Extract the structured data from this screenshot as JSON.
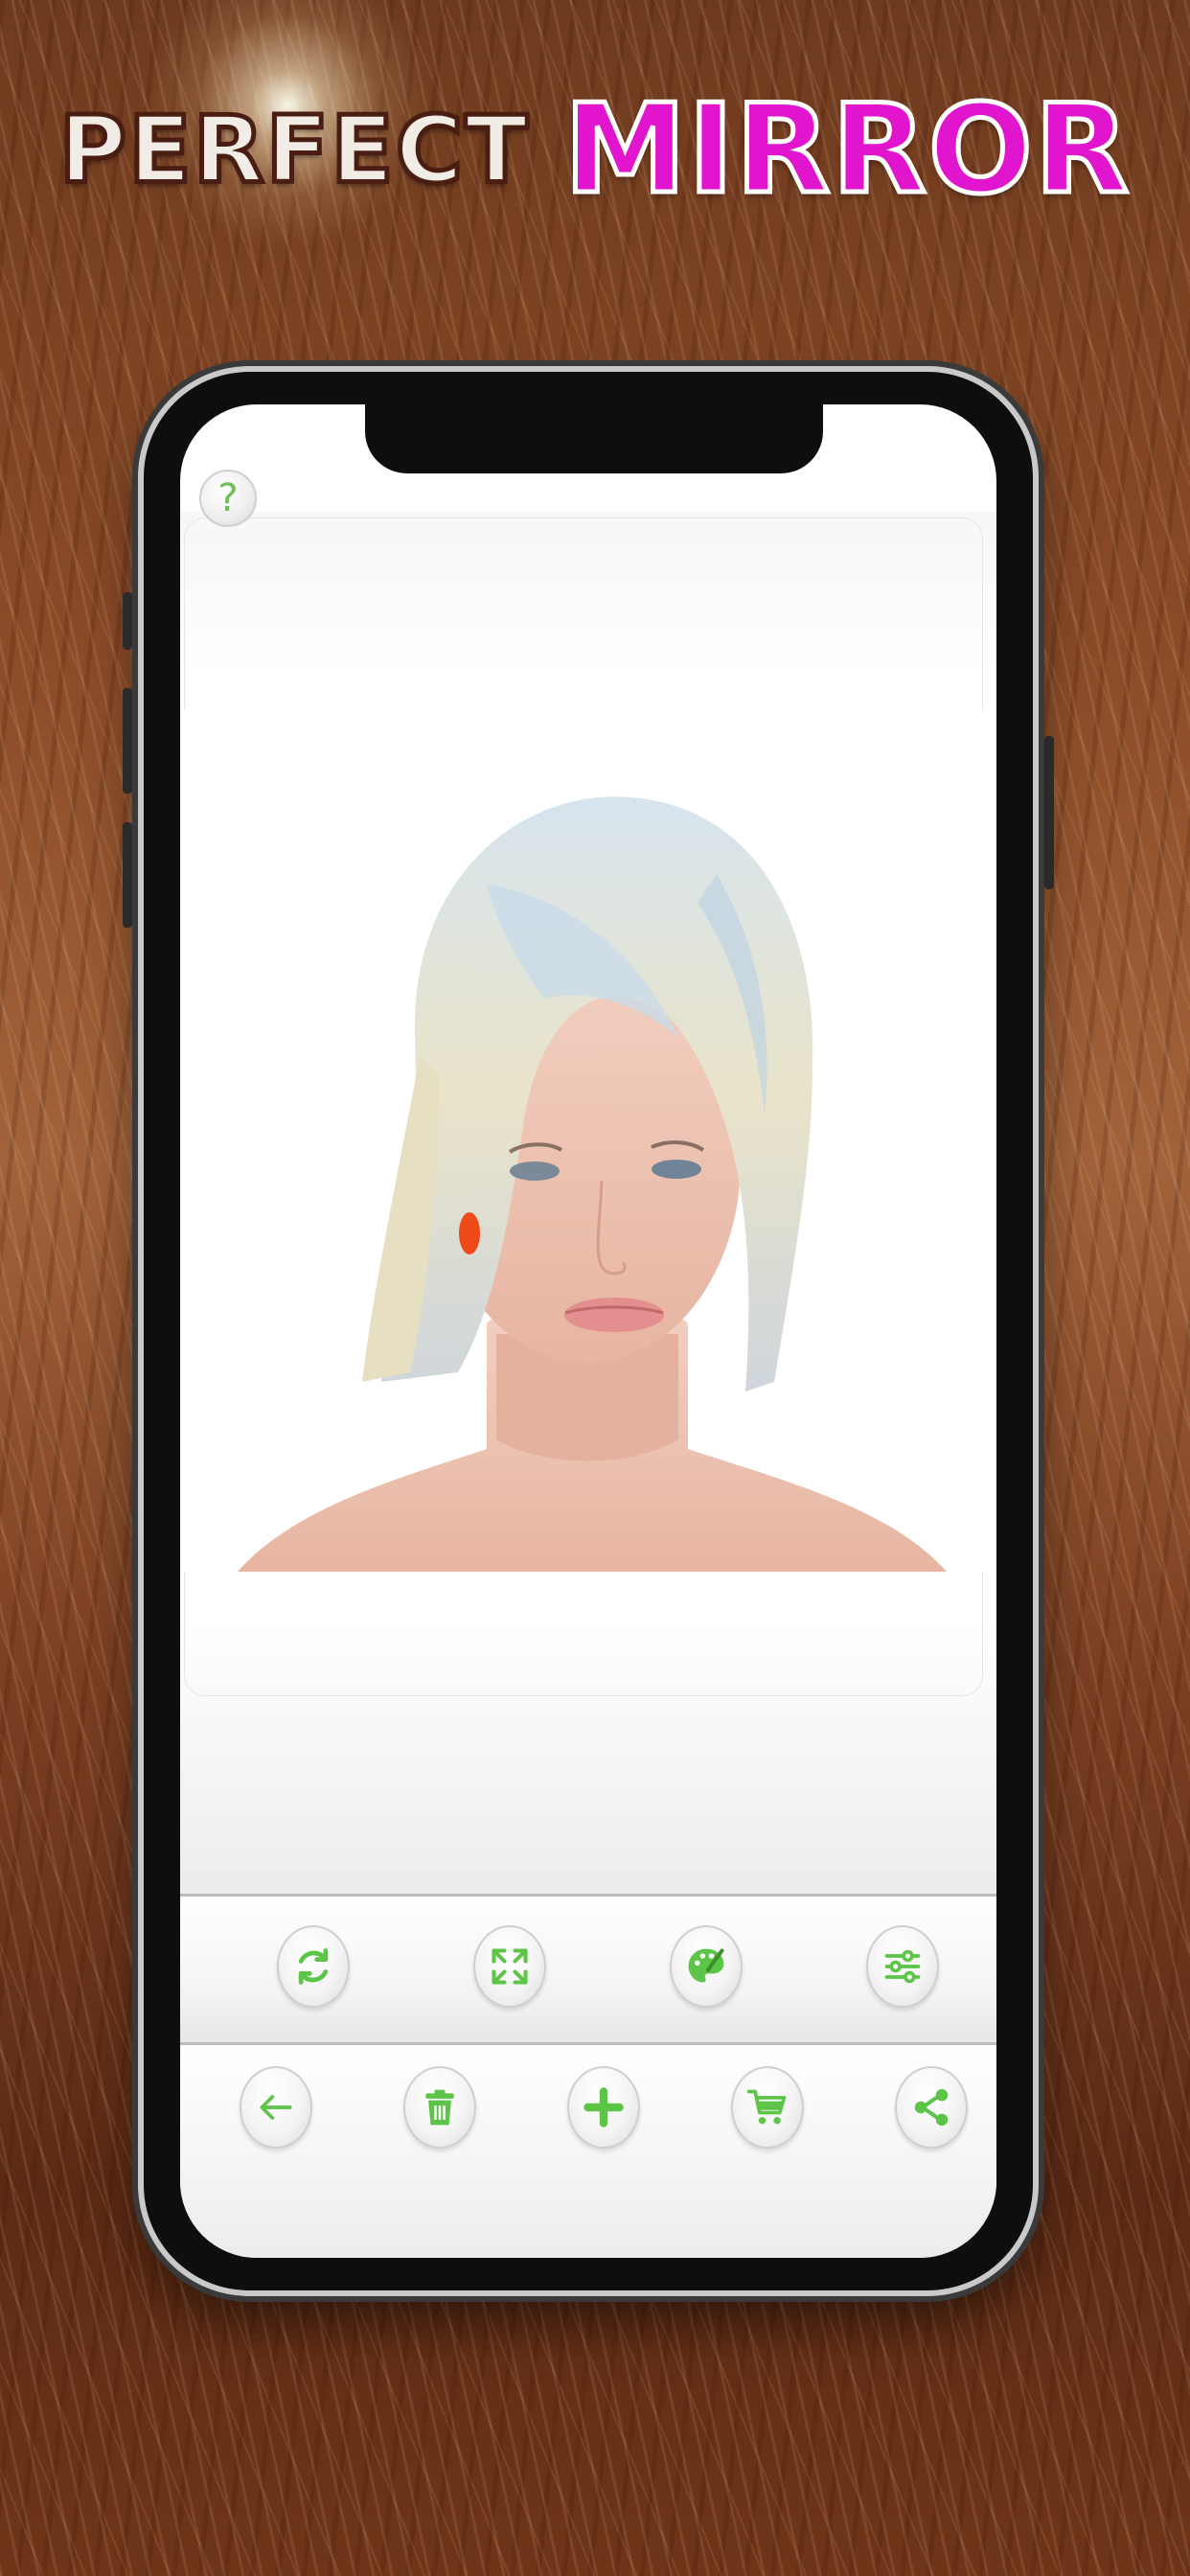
{
  "banner": {
    "title_part1": "PERFECT",
    "title_part2": "MIRROR"
  },
  "screen": {
    "help_label": "?",
    "photo_description_icon": "woman-with-platinum-bob-hairstyle"
  },
  "toolbar_top": {
    "buttons": [
      {
        "icon": "refresh-icon"
      },
      {
        "icon": "resize-icon"
      },
      {
        "icon": "palette-icon"
      },
      {
        "icon": "sliders-icon"
      }
    ]
  },
  "toolbar_bottom": {
    "buttons": [
      {
        "icon": "back-arrow-icon"
      },
      {
        "icon": "trash-icon"
      },
      {
        "icon": "add-icon"
      },
      {
        "icon": "cart-icon"
      },
      {
        "icon": "share-icon"
      }
    ]
  },
  "colors": {
    "accent_green": "#5cc446",
    "title_pink": "#e215cf",
    "background_hair": "#8a4b27"
  }
}
